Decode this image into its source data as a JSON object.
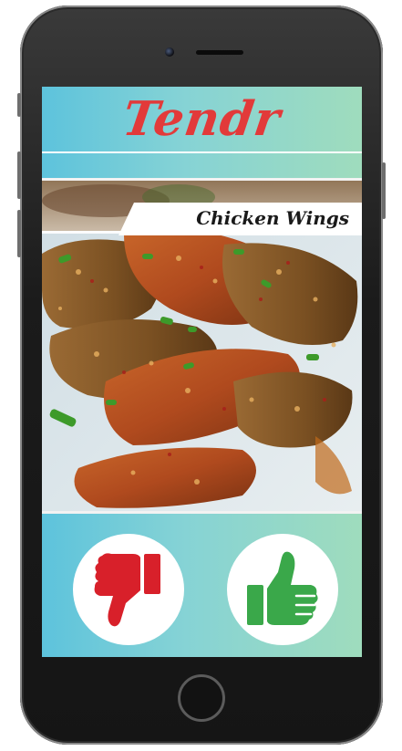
{
  "app": {
    "title": "Tendr",
    "brand_color": "#e23a3a"
  },
  "card": {
    "dish_name": "Chicken Wings",
    "image": "crispy-chicken-wings-photo"
  },
  "actions": {
    "dislike_icon": "thumbs-down-icon",
    "dislike_color": "#d8202a",
    "like_icon": "thumbs-up-icon",
    "like_color": "#3aa84a"
  }
}
